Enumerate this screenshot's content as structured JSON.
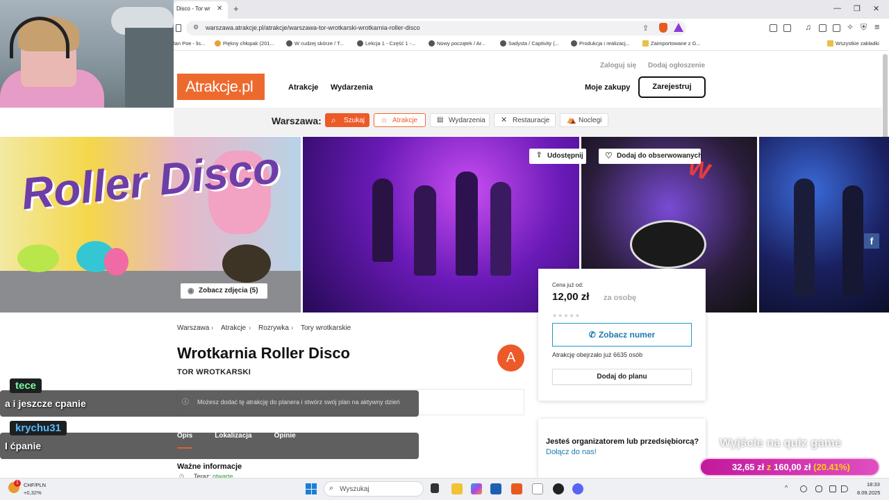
{
  "browser": {
    "tab_title": "Disco - Tor wr",
    "url": "warszawa.atrakcje.pl/atrakcje/warszawa-tor-wrotkarski-wrotkarnia-roller-disco",
    "bookmarks": [
      "lan Poe - lis...",
      "Piękny chłopak (201...",
      "W cudzej skórze / T...",
      "Lekcja 1 - Część 1 -...",
      "Nowy początek / Ar...",
      "Sadysta / Captivity (...",
      "Produkcja i realizacj...",
      "Zaimportowane z G..."
    ],
    "bookmarks_all": "Wszystkie zakładki"
  },
  "site": {
    "logo": "Atrakcje.pl",
    "nav": {
      "attractions": "Atrakcje",
      "events": "Wydarzenia",
      "my_purchases": "Moje zakupy"
    },
    "top_links": {
      "login": "Zaloguj się",
      "add_listing": "Dodaj ogłoszenie"
    },
    "register": "Zarejestruj",
    "search_strip": {
      "city": "Warszawa:",
      "search": "Szukaj",
      "attractions": "Atrakcje",
      "events": "Wydarzenia",
      "restaurants": "Restauracje",
      "lodging": "Noclegi"
    }
  },
  "gallery": {
    "see_photos": "Zobacz zdjęcia (5)",
    "share": "Udostępnij",
    "watch": "Dodaj do obserwowanych",
    "roller_text": "Roller Disco",
    "fb": "f"
  },
  "price_card": {
    "from_label": "Cena już od:",
    "price": "12,00 zł",
    "per": "za osobę",
    "stars": "★★★★★",
    "phone_btn": "Zobacz numer",
    "views": "Atrakcję obejrzało już 6635 osób",
    "plan_btn": "Dodaj do planu"
  },
  "org_card": {
    "question": "Jesteś organizatorem lub przedsiębiorcą?",
    "link": "Dołącz do nas!"
  },
  "content": {
    "breadcrumbs": [
      "Warszawa",
      "Atrakcje",
      "Rozrywka",
      "Tory wrotkarskie"
    ],
    "title": "Wrotkarnia Roller Disco",
    "subtitle": "TOR WROTKARSKI",
    "avatar": "A",
    "planner_info": "Możesz dodać tę atrakcję do planera i stwórz swój plan na aktywny dzień",
    "tabs": [
      "Opis",
      "Lokalizacja",
      "Opinie"
    ],
    "important": "Ważne informacje",
    "now_label": "Teraz:",
    "now_value": "otwarte"
  },
  "stream": {
    "chat": [
      {
        "user": "tece",
        "message": "a i jeszcze cpanie"
      },
      {
        "user": "krychu31",
        "message": "I ćpanie"
      }
    ],
    "quiz_text": "Wyjście na quiz game",
    "goal": {
      "current": "32,65 zł",
      "sep": "z",
      "target": "160,00 zł",
      "percent": "(20.41%)",
      "progress": 0.2041
    }
  },
  "taskbar": {
    "currency": "CHF/PLN",
    "change": "+0,32%",
    "badge": "1",
    "search": "Wyszukaj",
    "time": "18:33",
    "date": "8.09.2025"
  },
  "colors": {
    "brand": "#ed5a2a",
    "link": "#1b7ab0",
    "goal": "#c2189d"
  }
}
